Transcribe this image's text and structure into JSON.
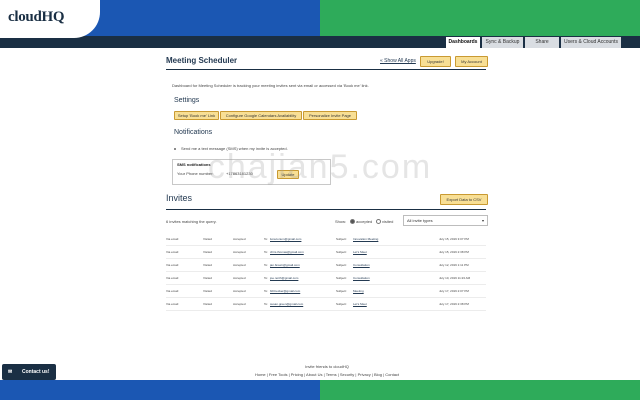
{
  "brand": {
    "logo": "cloudHQ"
  },
  "nav": {
    "tabs": [
      {
        "label": "Dashboards",
        "active": true
      },
      {
        "label": "Sync & Backup",
        "active": false
      },
      {
        "label": "Share",
        "active": false
      },
      {
        "label": "Users & Cloud Accounts",
        "active": false
      }
    ]
  },
  "header": {
    "title": "Meeting Scheduler",
    "show_all_apps": "« Show All Apps",
    "upgrade": "Upgrade!",
    "my_account": "My Account"
  },
  "intro": "Dashboard for Meeting Scheduler is tracking your meeting invites sent via email or accessed via 'Book me' link.",
  "settings": {
    "heading": "Settings",
    "buttons": [
      "Setup 'Book me' Link",
      "Configure Google Calendars Availability",
      "Personalize Invite Page"
    ]
  },
  "notifications": {
    "heading": "Notifications",
    "text": "Send me a text message (SMS) when my invite is accepted.",
    "sms_title": "SMS notifications",
    "phone_label": "Your Phone number:",
    "phone_value": "+17863181230",
    "update_label": "Update"
  },
  "invites": {
    "heading": "Invites",
    "export_label": "Export Data to CSV",
    "count_text": "6 invites matching the query.",
    "show_label": "Show:",
    "accepted_label": "accepted",
    "visited_label": "visited",
    "filter_value": "All invite types",
    "rows": [
      {
        "via": "Via email",
        "visited": "Visited",
        "status": "Accepted",
        "to_label": "To:",
        "to": "luna.lonum@gmail.com",
        "subject_label": "Subject:",
        "subject": "Innovation Meeting",
        "date": "July 15, 2019 3:07 PM"
      },
      {
        "via": "Via email",
        "visited": "Visited",
        "status": "Accepted",
        "to_label": "To:",
        "to": "chris.thomas@gmail.com",
        "subject_label": "Subject:",
        "subject": "Let's Meet",
        "date": "July 15, 2019 2:38 PM"
      },
      {
        "via": "Via email",
        "visited": "Visited",
        "status": "Accepted",
        "to_label": "To:",
        "to": "jan.brown@gmail.com",
        "subject_label": "Subject:",
        "subject": "Consultation",
        "date": "July 12, 2019 1:11 PM"
      },
      {
        "via": "Via email",
        "visited": "Visited",
        "status": "Accepted",
        "to_label": "To:",
        "to": "joe.north@gmail.com",
        "subject_label": "Subject:",
        "subject": "Consultation",
        "date": "July 10, 2019 11:23 AM"
      },
      {
        "via": "Via email",
        "visited": "Visited",
        "status": "Accepted",
        "to_label": "To:",
        "to": "bill.becker@gmail.com",
        "subject_label": "Subject:",
        "subject": "Meeting",
        "date": "July 17, 2019 2:07 PM"
      },
      {
        "via": "Via email",
        "visited": "Visited",
        "status": "Accepted",
        "to_label": "To:",
        "to": "susan.green@gmail.com",
        "subject_label": "Subject:",
        "subject": "Let's Meet",
        "date": "July 17, 2019 2:38 PM"
      }
    ]
  },
  "footer": {
    "invite_text": "Invite friends to cloudHQ",
    "links": [
      "Home",
      "Free Tools",
      "Pricing",
      "About Us",
      "Terms",
      "Security",
      "Privacy",
      "Blog",
      "Contact"
    ]
  },
  "contact": {
    "label": "Contact us!"
  },
  "watermark": "chajian5.com"
}
